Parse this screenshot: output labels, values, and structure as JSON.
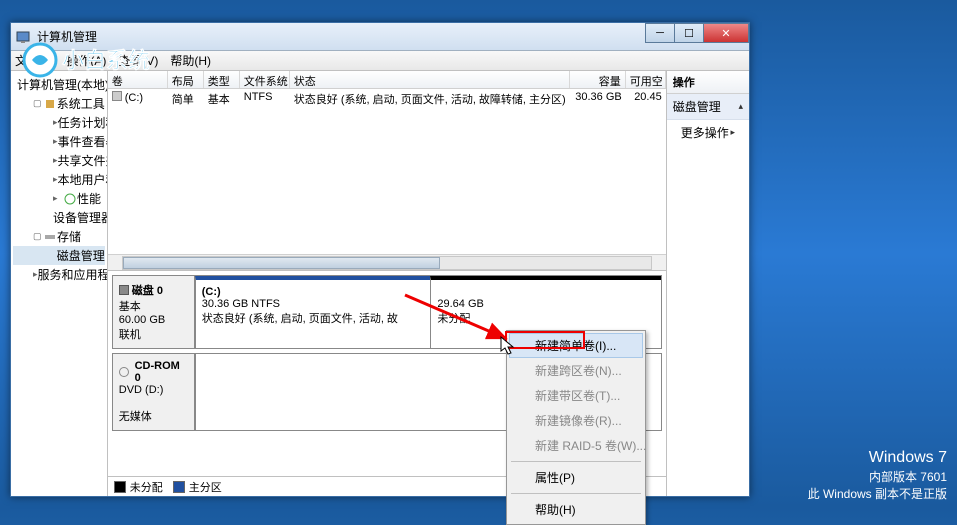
{
  "window": {
    "title": "计算机管理",
    "menu": {
      "file": "文件(F)",
      "action": "操作(A)",
      "view": "查看(V)",
      "help": "帮助(H)"
    }
  },
  "tree": {
    "root": "计算机管理(本地)",
    "groups": [
      {
        "label": "系统工具",
        "children": [
          "任务计划程序",
          "事件查看器",
          "共享文件夹",
          "本地用户和组",
          "性能",
          "设备管理器"
        ]
      },
      {
        "label": "存储",
        "children": [
          "磁盘管理"
        ]
      },
      {
        "label": "服务和应用程序",
        "children": []
      }
    ]
  },
  "vol_header": {
    "vol": "卷",
    "layout": "布局",
    "type": "类型",
    "fs": "文件系统",
    "status": "状态",
    "cap": "容量",
    "free": "可用空"
  },
  "vol_row": {
    "vol": "(C:)",
    "layout": "简单",
    "type": "基本",
    "fs": "NTFS",
    "status": "状态良好 (系统, 启动, 页面文件, 活动, 故障转储, 主分区)",
    "cap": "30.36 GB",
    "free": "20.45"
  },
  "disk0": {
    "name": "磁盘 0",
    "type": "基本",
    "size": "60.00 GB",
    "status": "联机",
    "part1": {
      "label": "(C:)",
      "line2": "30.36 GB NTFS",
      "line3": "状态良好 (系统, 启动, 页面文件, 活动, 故"
    },
    "part2": {
      "size": "29.64 GB",
      "status": "未分配"
    }
  },
  "cdrom": {
    "name": "CD-ROM 0",
    "drive": "DVD (D:)",
    "status": "无媒体"
  },
  "legend": {
    "unalloc": "未分配",
    "primary": "主分区"
  },
  "actions": {
    "header": "操作",
    "disk_mgmt": "磁盘管理",
    "more": "更多操作"
  },
  "context": {
    "new_simple": "新建简单卷(I)...",
    "new_span": "新建跨区卷(N)...",
    "new_stripe": "新建带区卷(T)...",
    "new_mirror": "新建镜像卷(R)...",
    "new_raid5": "新建 RAID-5 卷(W)...",
    "properties": "属性(P)",
    "help": "帮助(H)"
  },
  "desktop": {
    "os": "Windows 7",
    "build": "内部版本 7601",
    "notice": "此 Windows 副本不是正版"
  }
}
